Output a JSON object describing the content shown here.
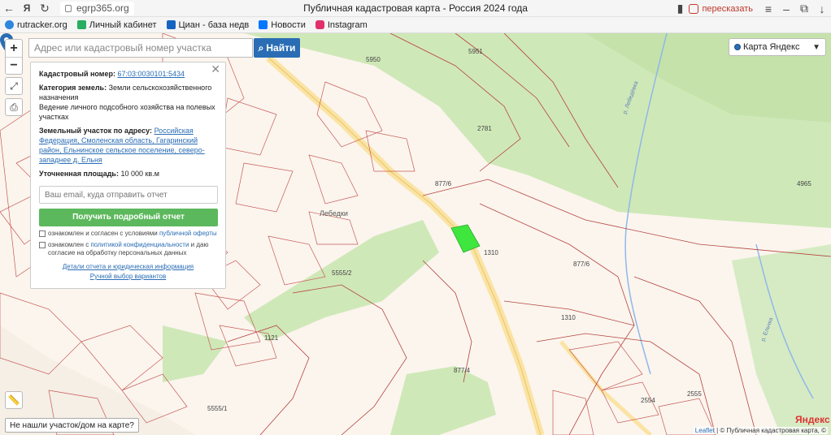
{
  "browser": {
    "url": "egrp365.org",
    "page_title": "Публичная кадастровая карта - Россия 2024 года",
    "share_label": "пересказать"
  },
  "bookmarks": [
    {
      "label": "rutracker.org",
      "color": "#2e86de"
    },
    {
      "label": "Личный кабинет",
      "color": "#27ae60"
    },
    {
      "label": "Циан - база недв",
      "color": "#1565c0"
    },
    {
      "label": "Новости",
      "color": "#0077ff"
    },
    {
      "label": "Instagram",
      "color": "#e1306c"
    }
  ],
  "search": {
    "placeholder": "Адрес или кадастровый номер участка",
    "button_label": "Найти"
  },
  "layer": {
    "label": "Карта Яндекс"
  },
  "panel": {
    "cadastral_label": "Кадастровый номер:",
    "cadastral_value": "67:03:0030101:5434",
    "category_label": "Категория земель:",
    "category_value": "Земли сельскохозяйственного назначения",
    "usage_value": "Ведение личного подсобного хозяйства на полевых участках",
    "address_label": "Земельный участок по адресу:",
    "address_value": "Российская Федерация, Смоленская область, Гагаринский район, Ельнинское сельское поселение, северо-западнее д. Ельня",
    "area_label": "Уточненная площадь:",
    "area_value": "10 000 кв.м",
    "email_placeholder": "Ваш email, куда отправить отчет",
    "report_button": "Получить подробный отчет",
    "consent1_prefix": "ознакомлен и согласен с условиями",
    "consent1_link": "публичной оферты",
    "consent2_prefix": "ознакомлен с",
    "consent2_link": "политикой конфиденциальности",
    "consent2_suffix": "и даю согласие на обработку персональных данных",
    "footer_link1": "Детали отчета и юридическая информация",
    "footer_link2": "Ручной выбор вариантов"
  },
  "map_labels": [
    {
      "text": "5950"
    },
    {
      "text": "5951"
    },
    {
      "text": "2781"
    },
    {
      "text": "4965"
    },
    {
      "text": "877/6"
    },
    {
      "text": "1310"
    },
    {
      "text": "877/6"
    },
    {
      "text": "1310"
    },
    {
      "text": "5555/2"
    },
    {
      "text": "1121"
    },
    {
      "text": "877/4"
    },
    {
      "text": "5555/1"
    },
    {
      "text": "2554"
    },
    {
      "text": "2555"
    },
    {
      "text": "Лебедки"
    },
    {
      "text": "р. Лебедёвка"
    },
    {
      "text": "р. Ельчка"
    }
  ],
  "not_found_label": "Не нашли участок/дом на карте?",
  "attribution": {
    "leaflet": "Leaflet",
    "rest": "| © Публичная кадастровая карта, ©"
  },
  "yandex_logo": "Яндекс",
  "colors": {
    "accent": "#2a6db5",
    "report": "#5cb85c",
    "parcel": "#3ee63e",
    "forest": "#cfe8b8",
    "boundary": "#b5443f"
  }
}
